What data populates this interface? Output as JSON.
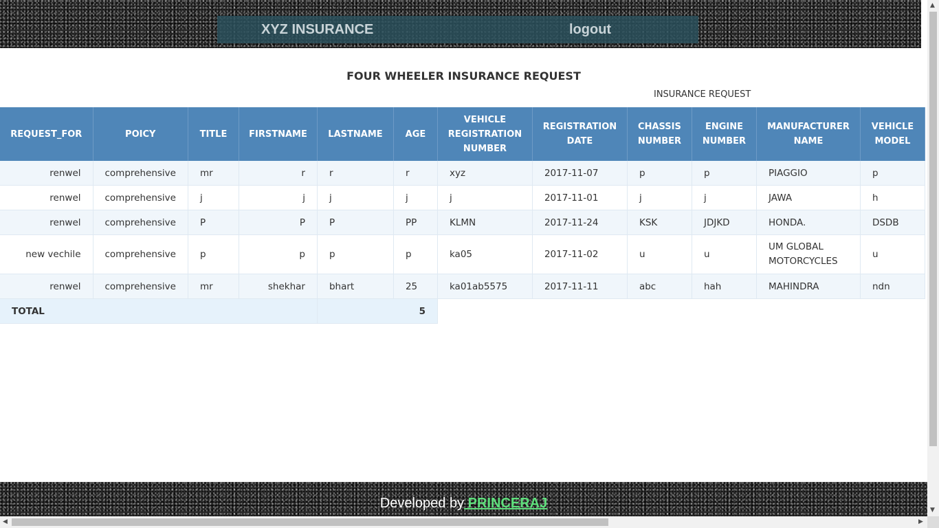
{
  "header": {
    "brand": "XYZ INSURANCE",
    "logout_label": "logout"
  },
  "page": {
    "title": "FOUR WHEELER INSURANCE REQUEST",
    "subtitle": "INSURANCE REQUEST"
  },
  "table": {
    "columns": [
      "REQUEST_FOR",
      "POICY",
      "TITLE",
      "FIRSTNAME",
      "LASTNAME",
      "AGE",
      "VEHICLE REGISTRATION NUMBER",
      "REGISTRATION DATE",
      "CHASSIS NUMBER",
      "ENGINE NUMBER",
      "MANUFACTURER NAME",
      "VEHICLE MODEL"
    ],
    "rows": [
      [
        "renwel",
        "comprehensive",
        "mr",
        "r",
        "r",
        "r",
        "xyz",
        "2017-11-07",
        "p",
        "p",
        "PIAGGIO",
        "p"
      ],
      [
        "renwel",
        "comprehensive",
        "j",
        "j",
        "j",
        "j",
        "j",
        "2017-11-01",
        "j",
        "j",
        "JAWA",
        "h"
      ],
      [
        "renwel",
        "comprehensive",
        "P",
        "P",
        "P",
        "PP",
        "KLMN",
        "2017-11-24",
        "KSK",
        "JDJKD",
        "HONDA.",
        "DSDB"
      ],
      [
        "new vechile",
        "comprehensive",
        "p",
        "p",
        "p",
        "p",
        "ka05",
        "2017-11-02",
        "u",
        "u",
        "UM GLOBAL MOTORCYCLES",
        "u"
      ],
      [
        "renwel",
        "comprehensive",
        "mr",
        "shekhar",
        "bhart",
        "25",
        "ka01ab5575",
        "2017-11-11",
        "abc",
        "hah",
        "MAHINDRA",
        "ndn"
      ]
    ],
    "total_label": "TOTAL",
    "total_value": "5"
  },
  "footer": {
    "prefix": "Developed by",
    "author": " PRINCERAJ"
  },
  "colors": {
    "header_bg": "#4f86b8",
    "nav_bg": "#2a505c",
    "link": "#5ee07c"
  }
}
